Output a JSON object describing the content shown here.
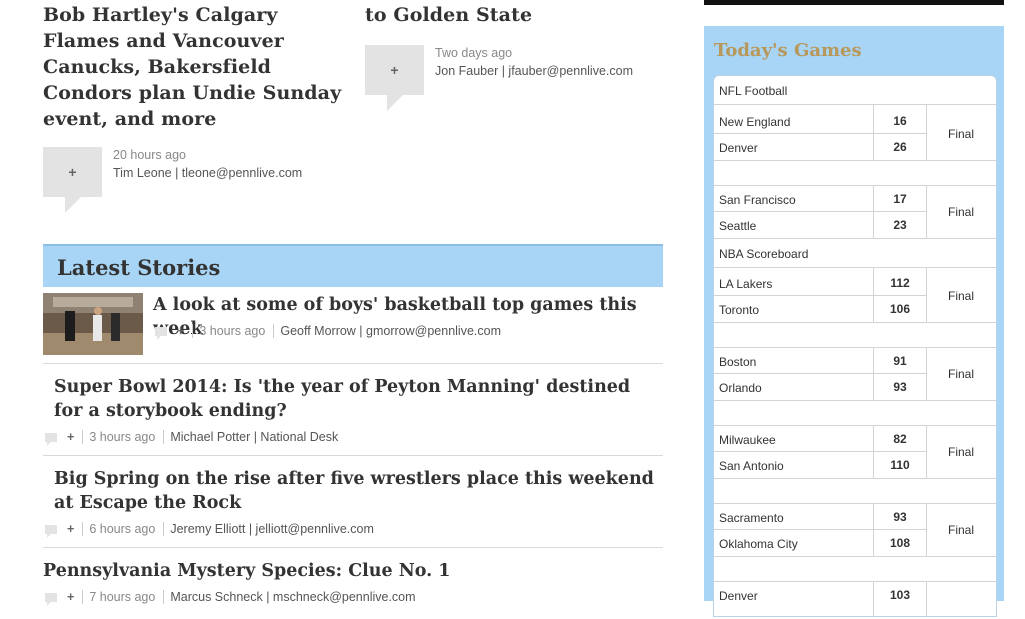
{
  "top_articles": [
    {
      "title": "Bob Hartley's Calgary Flames and Vancouver Canucks, Bakersfield Condors plan Undie Sunday event, and more",
      "time": "20 hours ago",
      "author": "Tim Leone | tleone@pennlive.com",
      "comment_label": "+"
    },
    {
      "title": "to Golden State",
      "time": "Two days ago",
      "author": "Jon Fauber | jfauber@pennlive.com",
      "comment_label": "+"
    }
  ],
  "latest": {
    "heading": "Latest Stories",
    "stories": [
      {
        "title": "A look at some of boys' basketball top games this week",
        "time": "3 hours ago",
        "author": "Geoff Morrow | gmorrow@pennlive.com",
        "plus": "+"
      },
      {
        "title": "Super Bowl 2014: Is 'the year of Peyton Manning' destined for a storybook ending?",
        "time": "3 hours ago",
        "author": "Michael Potter | National Desk",
        "plus": "+"
      },
      {
        "title": "Big Spring on the rise after five wrestlers place this weekend at Escape the Rock",
        "time": "6 hours ago",
        "author": "Jeremy Elliott | jelliott@pennlive.com",
        "plus": "+"
      },
      {
        "title": "Pennsylvania Mystery Species: Clue No. 1",
        "time": "7 hours ago",
        "author": "Marcus Schneck | mschneck@pennlive.com",
        "plus": "+"
      }
    ]
  },
  "games": {
    "title": "Today's Games",
    "nfl_label": "NFL Football",
    "nba_label": "NBA Scoreboard",
    "matchups": [
      {
        "team1": "New England",
        "score1": "16",
        "team2": "Denver",
        "score2": "26",
        "status": "Final"
      },
      {
        "team1": "San Francisco",
        "score1": "17",
        "team2": "Seattle",
        "score2": "23",
        "status": "Final"
      },
      {
        "team1": "LA Lakers",
        "score1": "112",
        "team2": "Toronto",
        "score2": "106",
        "status": "Final"
      },
      {
        "team1": "Boston",
        "score1": "91",
        "team2": "Orlando",
        "score2": "93",
        "status": "Final"
      },
      {
        "team1": "Milwaukee",
        "score1": "82",
        "team2": "San Antonio",
        "score2": "110",
        "status": "Final"
      },
      {
        "team1": "Sacramento",
        "score1": "93",
        "team2": "Oklahoma City",
        "score2": "108",
        "status": "Final"
      },
      {
        "team1": "Denver",
        "score1": "103",
        "team2": "",
        "score2": "",
        "status": ""
      }
    ]
  },
  "colors": {
    "panel": "#a8d4f5",
    "games_title": "#b8975a"
  },
  "icons": {
    "comment": "comment-bubble-icon"
  }
}
